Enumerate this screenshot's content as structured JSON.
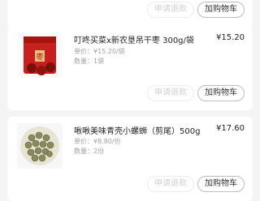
{
  "order_items": [
    {
      "refund_label": "申请退款",
      "cart_label": "加购物车"
    },
    {
      "title": "叮咚买菜x新农垦吊干枣 300g/袋",
      "price": "¥15.20",
      "unit_price": "单价：¥15.20/袋",
      "quantity": "数量：1袋",
      "refund_label": "申请退款",
      "cart_label": "加购物车"
    },
    {
      "title": "啾啾美味青壳小螺蛳（剪尾）500g",
      "price": "¥17.60",
      "unit_price": "单价：¥8.80/份",
      "quantity": "数量：2份",
      "refund_label": "申请退款",
      "cart_label": "加购物车"
    }
  ],
  "colors": {
    "background": "#f4f4f4",
    "card": "#ffffff",
    "text_primary": "#222222",
    "text_secondary": "#a0a0a0",
    "button_disabled_text": "#cfcfcf",
    "jujube_pack": "#c8201e"
  },
  "icons": [
    "jujube-product-image",
    "snail-product-image"
  ]
}
